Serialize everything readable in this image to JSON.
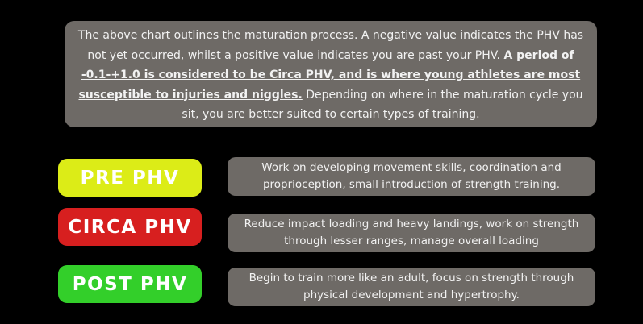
{
  "intro": {
    "line1": "The above chart outlines the maturation process. A negative value indicates the PHV has not yet occurred, whilst a positive value indicates you are past your PHV.",
    "emphasis": "A period of -0.1-+1.0 is considered to be Circa PHV, and is where young athletes are most susceptible to injuries and niggles.",
    "line3": "Depending on where in the maturation cycle you sit, you are better suited to certain types of training."
  },
  "phases": [
    {
      "label": "PRE PHV",
      "color": "#dcec17",
      "description": "Work on developing movement skills, coordination and proprioception, small introduction of strength training."
    },
    {
      "label": "CIRCA PHV",
      "color": "#d71f1f",
      "description": "Reduce impact loading and heavy landings, work on strength through lesser ranges, manage overall loading"
    },
    {
      "label": "POST PHV",
      "color": "#33cf2a",
      "description": "Begin to train more like an adult, focus on strength through physical development and hypertrophy."
    }
  ]
}
